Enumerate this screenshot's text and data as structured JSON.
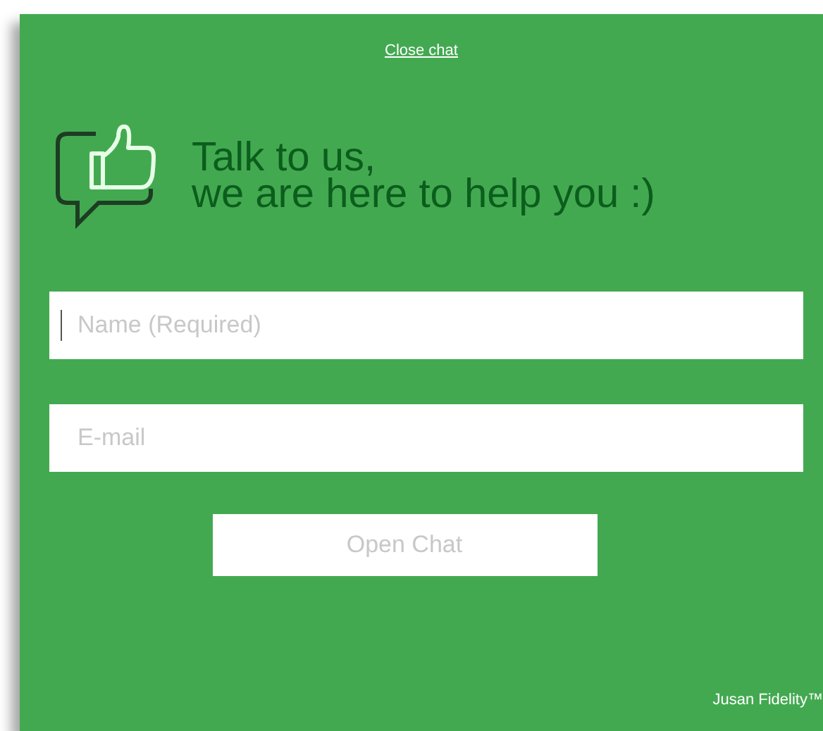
{
  "close_link": "Close chat",
  "heading": [
    "Talk to us,",
    "we are here to help you :)"
  ],
  "fields": [
    {
      "placeholder": "Name (Required)",
      "focused": true
    },
    {
      "placeholder": "E-mail",
      "focused": false
    }
  ],
  "button": "Open Chat",
  "footer": "Jusan Fidelity™"
}
